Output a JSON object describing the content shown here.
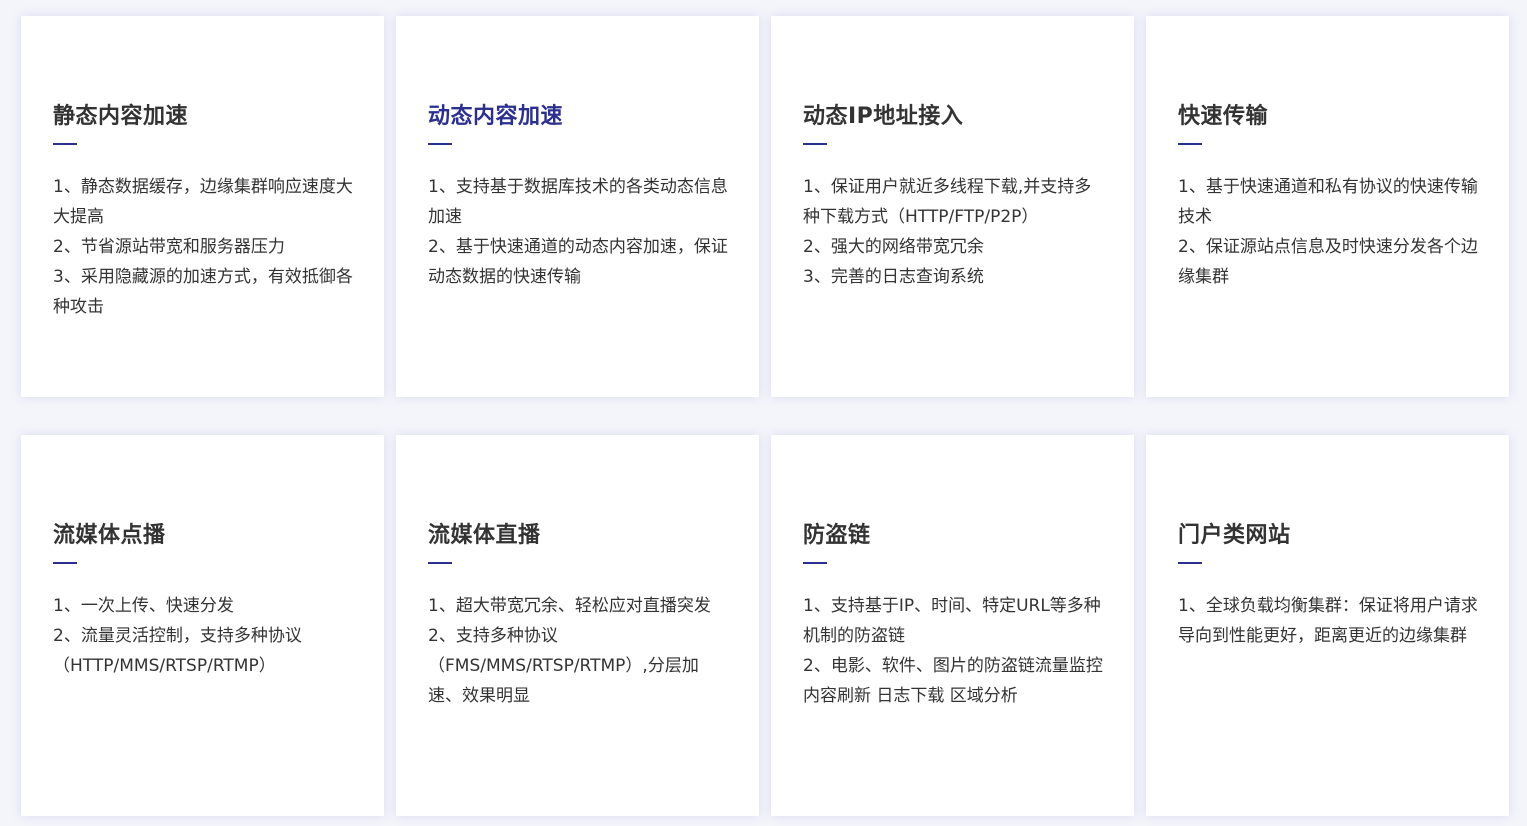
{
  "cards": [
    {
      "title": "静态内容加速",
      "items": [
        "1、静态数据缓存，边缘集群响应速度大大提高",
        "2、节省源站带宽和服务器压力",
        "3、采用隐藏源的加速方式，有效抵御各种攻击"
      ]
    },
    {
      "title": "动态内容加速",
      "items": [
        "1、支持基于数据库技术的各类动态信息加速",
        "2、基于快速通道的动态内容加速，保证动态数据的快速传输"
      ]
    },
    {
      "title": "动态IP地址接入",
      "items": [
        "1、保证用户就近多线程下载,并支持多种下载方式（HTTP/FTP/P2P）",
        "2、强大的网络带宽冗余",
        "3、完善的日志查询系统"
      ]
    },
    {
      "title": "快速传输",
      "items": [
        "1、基于快速通道和私有协议的快速传输技术",
        "2、保证源站点信息及时快速分发各个边缘集群"
      ]
    },
    {
      "title": "流媒体点播",
      "items": [
        "1、一次上传、快速分发",
        "2、流量灵活控制，支持多种协议（HTTP/MMS/RTSP/RTMP）"
      ]
    },
    {
      "title": "流媒体直播",
      "items": [
        "1、超大带宽冗余、轻松应对直播突发",
        "2、支持多种协议（FMS/MMS/RTSP/RTMP）,分层加速、效果明显"
      ]
    },
    {
      "title": "防盗链",
      "items": [
        "1、支持基于IP、时间、特定URL等多种机制的防盗链",
        "2、电影、软件、图片的防盗链流量监控 内容刷新 日志下载 区域分析"
      ]
    },
    {
      "title": "门户类网站",
      "items": [
        "1、全球负载均衡集群：保证将用户请求导向到性能更好，距离更近的边缘集群"
      ]
    }
  ],
  "colors": {
    "accent": "#2b2f8f",
    "text": "#333333",
    "card_bg": "#ffffff",
    "page_bg": "#f4f4fb"
  }
}
